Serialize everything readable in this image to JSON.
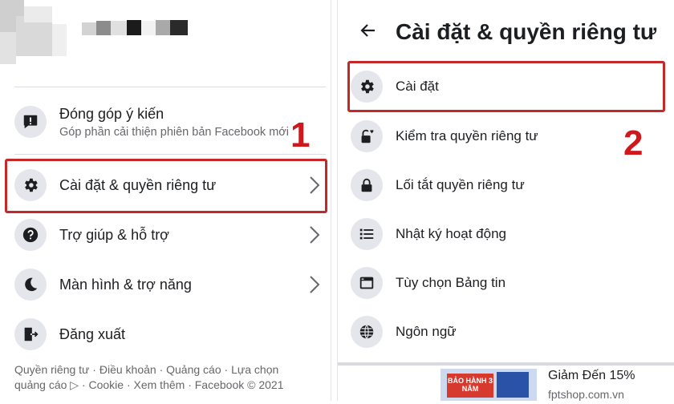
{
  "left": {
    "feedback": {
      "title": "Đóng góp ý kiến",
      "subtitle": "Góp phần cải thiện phiên bản Facebook mới"
    },
    "menu": [
      {
        "label": "Cài đặt & quyền riêng tư",
        "icon": "gear-icon",
        "has_chevron": true
      },
      {
        "label": "Trợ giúp & hỗ trợ",
        "icon": "question-icon",
        "has_chevron": true
      },
      {
        "label": "Màn hình & trợ năng",
        "icon": "moon-icon",
        "has_chevron": true
      },
      {
        "label": "Đăng xuất",
        "icon": "logout-icon",
        "has_chevron": false
      }
    ],
    "footer": {
      "line1": "Quyền riêng tư · Điều khoản · Quảng cáo · Lựa chọn",
      "line2": "quảng cáo ▷ · Cookie · Xem thêm · Facebook © 2021"
    },
    "step_marker": "1"
  },
  "right": {
    "title": "Cài đặt & quyền riêng tư",
    "items": [
      {
        "label": "Cài đặt",
        "icon": "gear-icon"
      },
      {
        "label": "Kiểm tra quyền riêng tư",
        "icon": "lock-heart-icon"
      },
      {
        "label": "Lối tắt quyền riêng tư",
        "icon": "lock-icon"
      },
      {
        "label": "Nhật ký hoạt động",
        "icon": "list-icon"
      },
      {
        "label": "Tùy chọn Bảng tin",
        "icon": "feed-icon"
      },
      {
        "label": "Ngôn ngữ",
        "icon": "globe-icon"
      }
    ],
    "step_marker": "2",
    "ad": {
      "banner_text": "BẢO HÀNH 3 NĂM",
      "title": "Giảm Đến 15%",
      "domain": "fptshop.com.vn"
    }
  },
  "colors": {
    "highlight": "#c62828",
    "marker": "#d0181c",
    "icon_bg": "#e4e6eb"
  }
}
